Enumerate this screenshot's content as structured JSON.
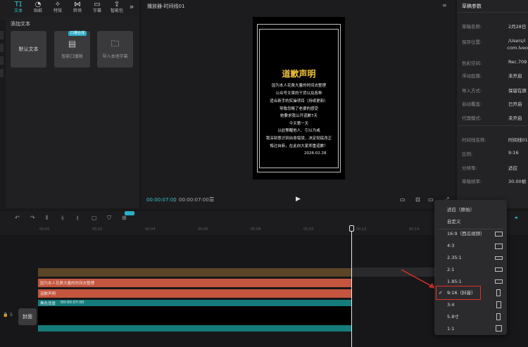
{
  "toolbar": {
    "tabs": [
      {
        "label": "文本",
        "icon": "text-icon"
      },
      {
        "label": "贴纸",
        "icon": "sticker-icon"
      },
      {
        "label": "特效",
        "icon": "effects-icon"
      },
      {
        "label": "转场",
        "icon": "transition-icon"
      },
      {
        "label": "字幕",
        "icon": "subtitle-icon"
      },
      {
        "label": "智能包",
        "icon": "package-icon"
      }
    ],
    "more": "»"
  },
  "left_panel": {
    "section_title": "添加文本",
    "cards": [
      {
        "label": "默认文本"
      },
      {
        "label": "智能口播稿",
        "badge": "口播合成"
      },
      {
        "label": "导入本地字幕"
      }
    ]
  },
  "player": {
    "title": "播放器-时间线01",
    "video": {
      "title": "道歉声明",
      "lines": [
        "因为本人花费大量的时间去整理",
        "公众号文章的干货以及各种",
        "适合新手的实操项目（持续更新）",
        "导致忽略了老婆的感受",
        "她要求我公开道歉7天",
        "今天第一天",
        "以此警醒他人、引以为戒",
        "我深刻意识到自身错误，决定彻底改正",
        "悔过自新，在此向大家郑重道歉！"
      ],
      "date": "2026.02.28"
    },
    "time_current": "00:00:07:00",
    "time_total": "00:00:07:00"
  },
  "params": {
    "title": "草稿参数",
    "rows": [
      {
        "k": "草稿名称:",
        "v": "2月28日"
      },
      {
        "k": "保存位置:",
        "v": "/Users/i"
      },
      {
        "k": "",
        "v": "com.lveo"
      },
      {
        "k": "色彩空间:",
        "v": "Rec.709"
      },
      {
        "k": "浮动层路:",
        "v": "未开启"
      },
      {
        "k": "导入方式:",
        "v": "保留在原"
      },
      {
        "k": "自动覆盖:",
        "v": "已开启"
      },
      {
        "k": "代理模式:",
        "v": "未开启"
      },
      {
        "k": "时间线名称:",
        "v": "时间线01"
      },
      {
        "k": "比例:",
        "v": "9:16"
      },
      {
        "k": "分辨率:",
        "v": "适应"
      },
      {
        "k": "草稿帧率:",
        "v": "30.00帧"
      }
    ]
  },
  "timeline": {
    "ticks": [
      "00:00",
      "00:02",
      "00:04",
      "00:06",
      "00:08",
      "00:10",
      "00:12",
      "00:14"
    ],
    "track_text1": "因为本人花费大量的时间去整理",
    "track_text2": "道歉声明",
    "track_video_name": "黑色背景",
    "track_video_time": "00:00:07:00",
    "cover_label": "封面",
    "side_icons": [
      "🔒",
      "S"
    ]
  },
  "ratio_menu": {
    "items": [
      {
        "label": "适应（原始）",
        "icon": null,
        "selected": false
      },
      {
        "label": "自定义",
        "icon": null,
        "selected": false
      },
      {
        "label": "16:9（西瓜视频）",
        "icon": "wide",
        "selected": false
      },
      {
        "label": "4:3",
        "icon": "wide",
        "selected": false
      },
      {
        "label": "2.35:1",
        "icon": "wide",
        "selected": false
      },
      {
        "label": "2:1",
        "icon": "wide",
        "selected": false
      },
      {
        "label": "1.85:1",
        "icon": "wide",
        "selected": false
      },
      {
        "label": "9:16（抖音）",
        "icon": "tall",
        "selected": true
      },
      {
        "label": "3:4",
        "icon": "tall",
        "selected": false
      },
      {
        "label": "5.8寸",
        "icon": "tall",
        "selected": false
      },
      {
        "label": "1:1",
        "icon": "square",
        "selected": false
      }
    ],
    "check": "✓"
  },
  "colors": {
    "accent": "#35c6d0",
    "highlight_box": "#e0302a",
    "text_track": "#c4553f",
    "video_track": "#167b7b",
    "video_title": "#f1c23a"
  }
}
